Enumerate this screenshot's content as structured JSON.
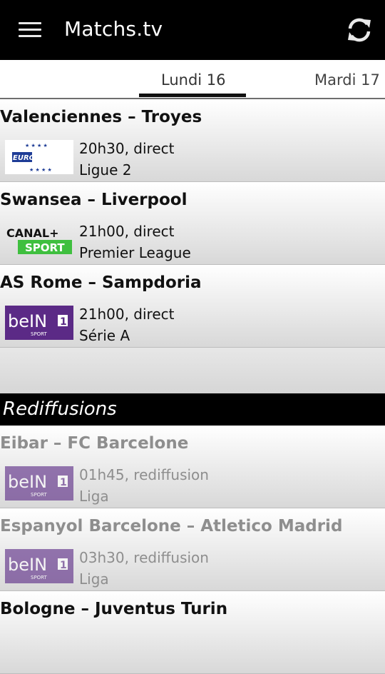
{
  "app": {
    "title": "Matchs.tv"
  },
  "tabs": {
    "active": "Lundi 16",
    "next": "Mardi 17"
  },
  "matches": [
    {
      "title": "Valenciennes – Troyes",
      "channel": "eurosport-logo",
      "time": "20h30, direct",
      "league": "Ligue 2"
    },
    {
      "title": "Swansea – Liverpool",
      "channel": "canal-plus-sport-logo",
      "time": "21h00, direct",
      "league": "Premier League"
    },
    {
      "title": "AS Rome – Sampdoria",
      "channel": "bein-sport-1-logo",
      "time": "21h00, direct",
      "league": "Série A"
    }
  ],
  "rebroadcasts": {
    "heading": "Rediffusions",
    "items": [
      {
        "title": "Eibar – FC Barcelone",
        "channel": "bein-sport-1-logo",
        "time": "01h45, rediffusion",
        "league": "Liga"
      },
      {
        "title": "Espanyol Barcelone – Atletico Madrid",
        "channel": "bein-sport-1-logo",
        "time": "03h30, rediffusion",
        "league": "Liga"
      },
      {
        "title": "Bologne – Juventus Turin",
        "channel": "bein-sport-1-logo",
        "time": "",
        "league": ""
      }
    ]
  },
  "logos": {
    "eurosport": {
      "word": "EUROSPORT",
      "color": "#1e3c96"
    },
    "canal": {
      "top": "CANAL+",
      "bottom": "SPORT",
      "color": "#3fbf3f"
    },
    "bein": {
      "word": "beIN",
      "number": "1",
      "sub": "SPORT",
      "color": "#5b2a86"
    }
  },
  "colors": {
    "appbar": "#000000",
    "section": "#000000",
    "bein_purple": "#5b2a86",
    "canal_green": "#3fbf3f",
    "eurosport_blue": "#1e3c96"
  }
}
